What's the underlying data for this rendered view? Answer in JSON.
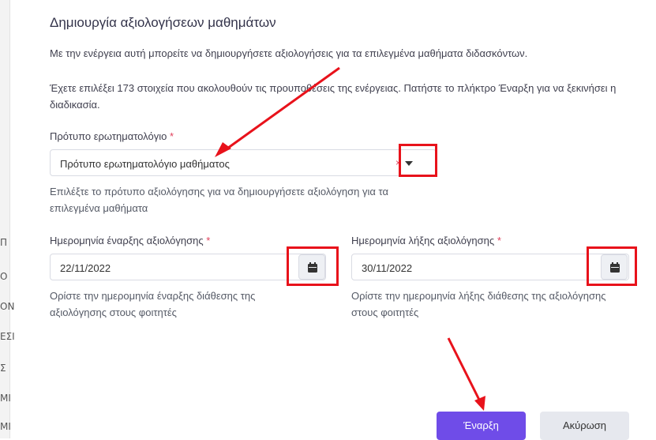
{
  "background": {
    "side_chars": [
      "Π",
      "Ο",
      "ΟΝ",
      "ΕΣΙ",
      "Σ",
      "ΜΙ",
      "ΜΙ"
    ]
  },
  "modal": {
    "title": "Δημιουργία αξιολογήσεων μαθημάτων",
    "description": "Με την ενέργεια αυτή μπορείτε να δημιουργήσετε αξιολογήσεις για τα επιλεγμένα μαθήματα διδασκόντων.",
    "selection_info": "Έχετε επιλέξει 173 στοιχεία που ακολουθούν τις προυποθέσεις της ενέργειας. Πατήστε το πλήκτρο Έναρξη για να ξεκινήσει η διαδικασία.",
    "template_field": {
      "label": "Πρότυπο ερωτηματολόγιο",
      "required_mark": "*",
      "value": "Πρότυπο ερωτηματολόγιο μαθήματος",
      "clear_symbol": "×",
      "hint": "Επιλέξτε το πρότυπο αξιολόγησης για να δημιουργήσετε αξιολόγηση για τα επιλεγμένα μαθήματα"
    },
    "start_date": {
      "label": "Ημερομηνία έναρξης αξιολόγησης",
      "required_mark": "*",
      "value": "22/11/2022",
      "hint": "Ορίστε την ημερομηνία έναρξης διάθεσης της αξιολόγησης στους φοιτητές"
    },
    "end_date": {
      "label": "Ημερομηνία λήξης αξιολόγησης",
      "required_mark": "*",
      "value": "30/11/2022",
      "hint": "Ορίστε την ημερομηνία λήξης διάθεσης της αξιολόγησης στους φοιτητές"
    },
    "buttons": {
      "start": "Έναρξη",
      "cancel": "Ακύρωση"
    }
  },
  "colors": {
    "primary": "#6f4ce8",
    "annotation": "#e8121b",
    "required": "#e0405b"
  },
  "icons": {
    "dropdown": "caret-down-icon",
    "calendar": "calendar-icon"
  }
}
